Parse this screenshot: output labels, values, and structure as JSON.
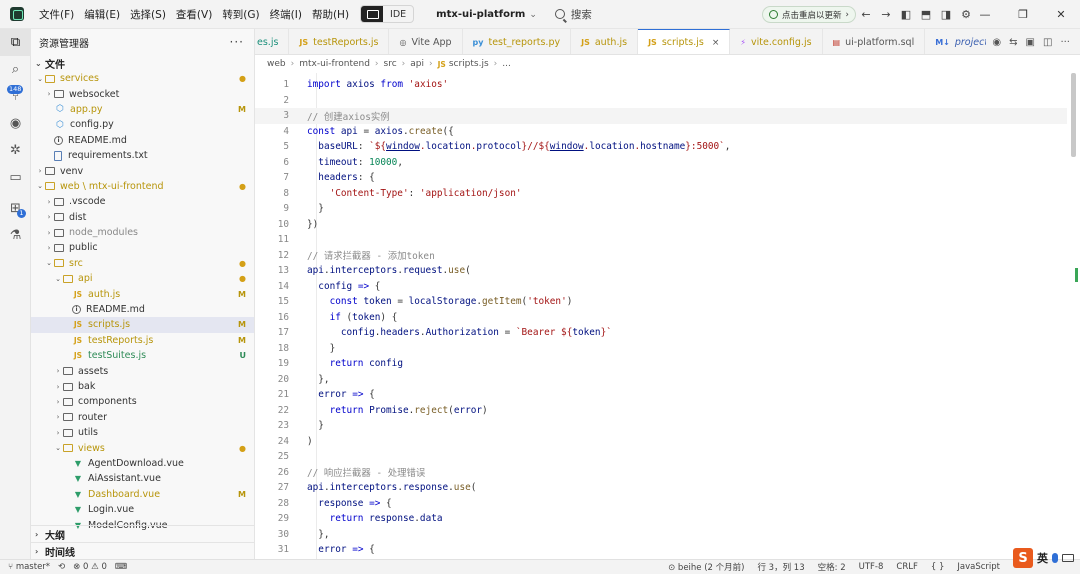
{
  "titlebar": {
    "menus": [
      "文件(F)",
      "编辑(E)",
      "选择(S)",
      "查看(V)",
      "转到(G)",
      "终端(I)",
      "帮助(H)"
    ],
    "mode_label": "IDE",
    "project": "mtx-ui-platform",
    "search": "搜索",
    "update": "点击重启以更新"
  },
  "activity": {
    "badge_count": "148",
    "badge_small": "1"
  },
  "sidebar": {
    "title": "资源管理器",
    "section_files": "文件",
    "section_outline": "大纲",
    "section_timeline": "时间线",
    "tree": [
      {
        "label": "services",
        "type": "folder-open",
        "indent": 0,
        "status": "dot",
        "color": "mod"
      },
      {
        "label": "websocket",
        "type": "folder",
        "indent": 1,
        "arrow": "›",
        "status": ""
      },
      {
        "label": "app.py",
        "type": "py",
        "indent": 1,
        "status": "M",
        "color": "mod"
      },
      {
        "label": "config.py",
        "type": "py",
        "indent": 1,
        "status": ""
      },
      {
        "label": "README.md",
        "type": "info",
        "indent": 1,
        "status": ""
      },
      {
        "label": "requirements.txt",
        "type": "txt",
        "indent": 1,
        "status": ""
      },
      {
        "label": "venv",
        "type": "folder",
        "indent": 0,
        "arrow": "›",
        "status": ""
      },
      {
        "label": "web \\ mtx-ui-frontend",
        "type": "folder-open",
        "indent": 0,
        "status": "dot",
        "color": "mod"
      },
      {
        "label": ".vscode",
        "type": "folder",
        "indent": 1,
        "arrow": "›",
        "status": ""
      },
      {
        "label": "dist",
        "type": "folder",
        "indent": 1,
        "arrow": "›",
        "status": ""
      },
      {
        "label": "node_modules",
        "type": "folder",
        "indent": 1,
        "arrow": "›",
        "status": "",
        "color": "dim"
      },
      {
        "label": "public",
        "type": "folder",
        "indent": 1,
        "arrow": "›",
        "status": ""
      },
      {
        "label": "src",
        "type": "folder-open",
        "indent": 1,
        "status": "dot",
        "color": "mod"
      },
      {
        "label": "api",
        "type": "folder-open",
        "indent": 2,
        "status": "dot",
        "color": "mod"
      },
      {
        "label": "auth.js",
        "type": "js",
        "indent": 3,
        "status": "M",
        "color": "mod"
      },
      {
        "label": "README.md",
        "type": "info",
        "indent": 3,
        "status": ""
      },
      {
        "label": "scripts.js",
        "type": "js",
        "indent": 3,
        "status": "M",
        "color": "mod",
        "selected": true
      },
      {
        "label": "testReports.js",
        "type": "js",
        "indent": 3,
        "status": "M",
        "color": "mod"
      },
      {
        "label": "testSuites.js",
        "type": "js",
        "indent": 3,
        "status": "U",
        "color": "new"
      },
      {
        "label": "assets",
        "type": "folder",
        "indent": 2,
        "arrow": "›",
        "status": ""
      },
      {
        "label": "bak",
        "type": "folder",
        "indent": 2,
        "arrow": "›",
        "status": ""
      },
      {
        "label": "components",
        "type": "folder",
        "indent": 2,
        "arrow": "›",
        "status": ""
      },
      {
        "label": "router",
        "type": "folder",
        "indent": 2,
        "arrow": "›",
        "status": ""
      },
      {
        "label": "utils",
        "type": "folder",
        "indent": 2,
        "arrow": "›",
        "status": ""
      },
      {
        "label": "views",
        "type": "folder-open",
        "indent": 2,
        "status": "dot",
        "color": "mod"
      },
      {
        "label": "AgentDownload.vue",
        "type": "vue",
        "indent": 3,
        "status": ""
      },
      {
        "label": "AiAssistant.vue",
        "type": "vue",
        "indent": 3,
        "status": ""
      },
      {
        "label": "Dashboard.vue",
        "type": "vue",
        "indent": 3,
        "status": "M",
        "color": "mod"
      },
      {
        "label": "Login.vue",
        "type": "vue",
        "indent": 3,
        "status": ""
      },
      {
        "label": "ModelConfig.vue",
        "type": "vue",
        "indent": 3,
        "status": ""
      }
    ]
  },
  "tabs": [
    {
      "label": "es.js",
      "icon": "",
      "partial": true
    },
    {
      "label": "testReports.js",
      "icon": "JS",
      "color": "mod"
    },
    {
      "label": "Vite App",
      "icon": "◎"
    },
    {
      "label": "test_reports.py",
      "icon": "py",
      "color": "mod"
    },
    {
      "label": "auth.js",
      "icon": "JS",
      "color": "mod"
    },
    {
      "label": "scripts.js",
      "icon": "JS",
      "active": true,
      "color": "mod",
      "close": "×"
    },
    {
      "label": "vite.config.js",
      "icon": "⚡",
      "color": "mod"
    },
    {
      "label": "ui-platform.sql",
      "icon": "▤"
    },
    {
      "label": "project_rules.md",
      "icon": "M↓",
      "italic": true
    }
  ],
  "breadcrumb": [
    "web",
    "mtx-ui-frontend",
    "src",
    "api",
    "scripts.js",
    "..."
  ],
  "code_lines": [
    "<span class='k'>import</span> <span class='v'>axios</span> <span class='k'>from</span> <span class='s'>'axios'</span>",
    "",
    "<span class='cm'>// 创建axios实例</span>",
    "<span class='k'>const</span> <span class='v'>api</span> = <span class='v'>axios</span>.<span class='f'>create</span>({",
    "  <span class='v'>baseURL</span>: <span class='s'>`${<span class='v u'>window</span>.<span class='v'>location</span>.<span class='v'>protocol</span>}//${<span class='v u'>window</span>.<span class='v'>location</span>.<span class='v'>hostname</span>}:5000`</span>,",
    "  <span class='v'>timeout</span>: <span class='n'>10000</span>,",
    "  <span class='v'>headers</span>: {",
    "    <span class='s'>'Content-Type'</span>: <span class='s'>'application/json'</span>",
    "  }",
    "})",
    "",
    "<span class='cm'>// 请求拦截器 - 添加token</span>",
    "<span class='v'>api</span>.<span class='v'>interceptors</span>.<span class='v'>request</span>.<span class='f'>use</span>(",
    "  <span class='v'>config</span> <span class='k'>=&gt;</span> {",
    "    <span class='k'>const</span> <span class='v'>token</span> = <span class='v'>localStorage</span>.<span class='f'>getItem</span>(<span class='s'>'token'</span>)",
    "    <span class='k'>if</span> (<span class='v'>token</span>) {",
    "      <span class='v'>config</span>.<span class='v'>headers</span>.<span class='v'>Authorization</span> = <span class='s'>`Bearer ${<span class='v'>token</span>}`</span>",
    "    }",
    "    <span class='k'>return</span> <span class='v'>config</span>",
    "  },",
    "  <span class='v'>error</span> <span class='k'>=&gt;</span> {",
    "    <span class='k'>return</span> <span class='v'>Promise</span>.<span class='f'>reject</span>(<span class='v'>error</span>)",
    "  }",
    ")",
    "",
    "<span class='cm'>// 响应拦截器 - 处理错误</span>",
    "<span class='v'>api</span>.<span class='v'>interceptors</span>.<span class='v'>response</span>.<span class='f'>use</span>(",
    "  <span class='v'>response</span> <span class='k'>=&gt;</span> {",
    "    <span class='k'>return</span> <span class='v'>response</span>.<span class='v'>data</span>",
    "  },",
    "  <span class='v'>error</span> <span class='k'>=&gt;</span> {"
  ],
  "statusbar": {
    "branch": "master*",
    "errors": "0",
    "warnings": "0",
    "author": "beihe (2 个月前)",
    "position": "行 3，列 13",
    "indent": "空格: 2",
    "encoding": "UTF-8",
    "eol": "CRLF",
    "braces": "{ }",
    "language": "JavaScript",
    "ime": "英"
  }
}
